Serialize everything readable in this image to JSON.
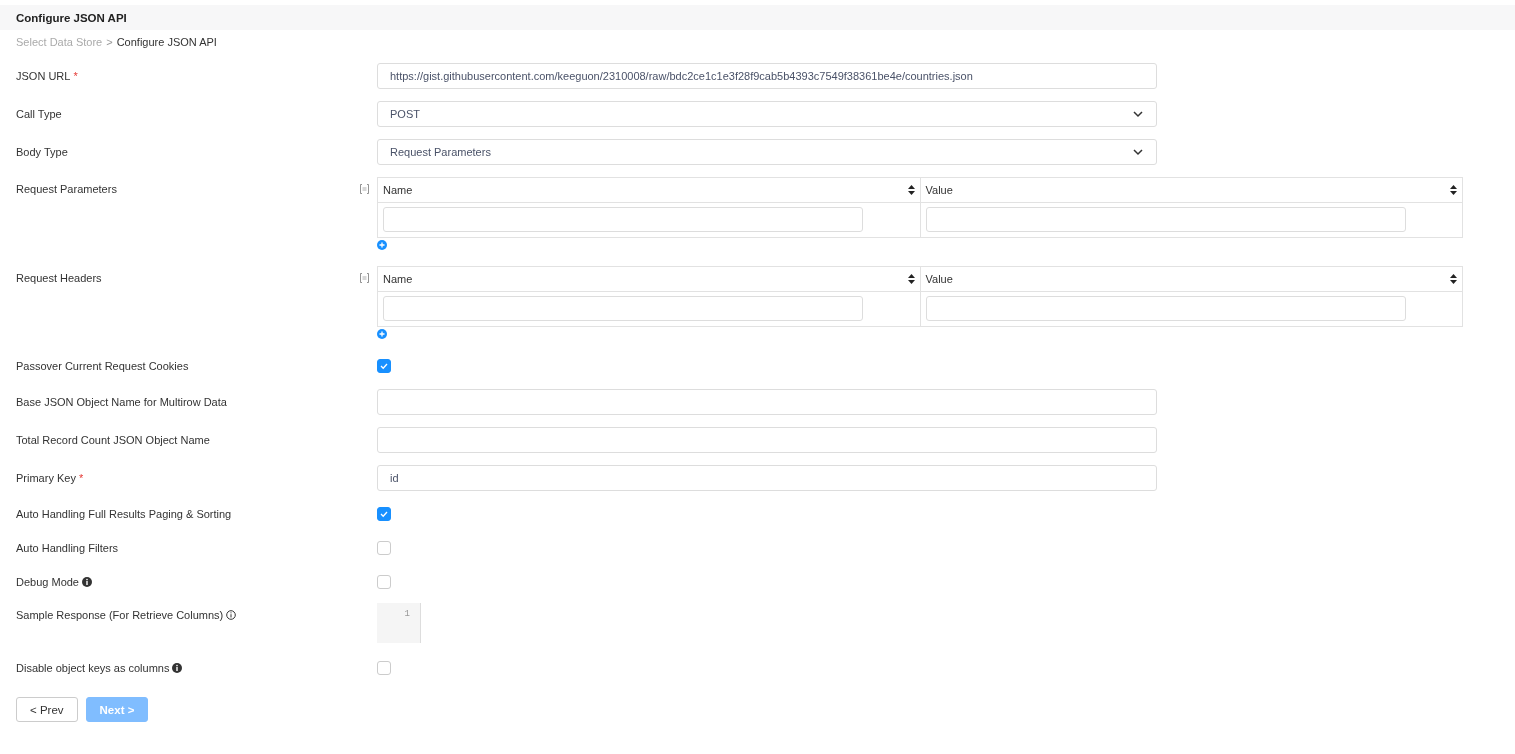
{
  "header": {
    "title": "Configure JSON API"
  },
  "breadcrumb": {
    "items": [
      {
        "label": "Select Data Store",
        "current": false
      },
      {
        "label": "Configure JSON API",
        "current": true
      }
    ],
    "separator": ">"
  },
  "fields": [
    {
      "kind": "text",
      "label": "JSON URL",
      "required_mark": "*",
      "value": "https://gist.githubusercontent.com/keeguon/2310008/raw/bdc2ce1c1e3f28f9cab5b4393c7549f38361be4e/countries.json"
    },
    {
      "kind": "select",
      "label": "Call Type",
      "value": "POST"
    },
    {
      "kind": "select",
      "label": "Body Type",
      "value": "Request Parameters"
    },
    {
      "kind": "table",
      "label": "Request Parameters",
      "columns": [
        {
          "label": "Name"
        },
        {
          "label": "Value"
        }
      ]
    },
    {
      "kind": "table",
      "label": "Request Headers",
      "columns": [
        {
          "label": "Name"
        },
        {
          "label": "Value"
        }
      ]
    },
    {
      "kind": "checkbox",
      "label": "Passover Current Request Cookies",
      "checked": true
    },
    {
      "kind": "text",
      "label": "Base JSON Object Name for Multirow Data"
    },
    {
      "kind": "text",
      "label": "Total Record Count JSON Object Name"
    },
    {
      "kind": "text",
      "label": "Primary Key",
      "required_mark": "*",
      "value": "id"
    },
    {
      "kind": "checkbox",
      "label": "Auto Handling Full Results Paging & Sorting",
      "checked": true
    },
    {
      "kind": "checkbox",
      "label": "Auto Handling Filters",
      "checked": false
    },
    {
      "kind": "checkbox",
      "label": "Debug Mode",
      "info": {
        "filled": true
      },
      "checked": false
    },
    {
      "kind": "code",
      "label": "Sample Response (For Retrieve Columns)",
      "info": {
        "filled": false
      },
      "line_numbers": [
        "1"
      ]
    },
    {
      "kind": "checkbox",
      "label": "Disable object keys as columns",
      "info": {
        "filled": true
      },
      "checked": false
    }
  ],
  "buttons": [
    {
      "label": "< Prev",
      "disabled": false
    },
    {
      "label": "Next >",
      "disabled": true
    }
  ]
}
